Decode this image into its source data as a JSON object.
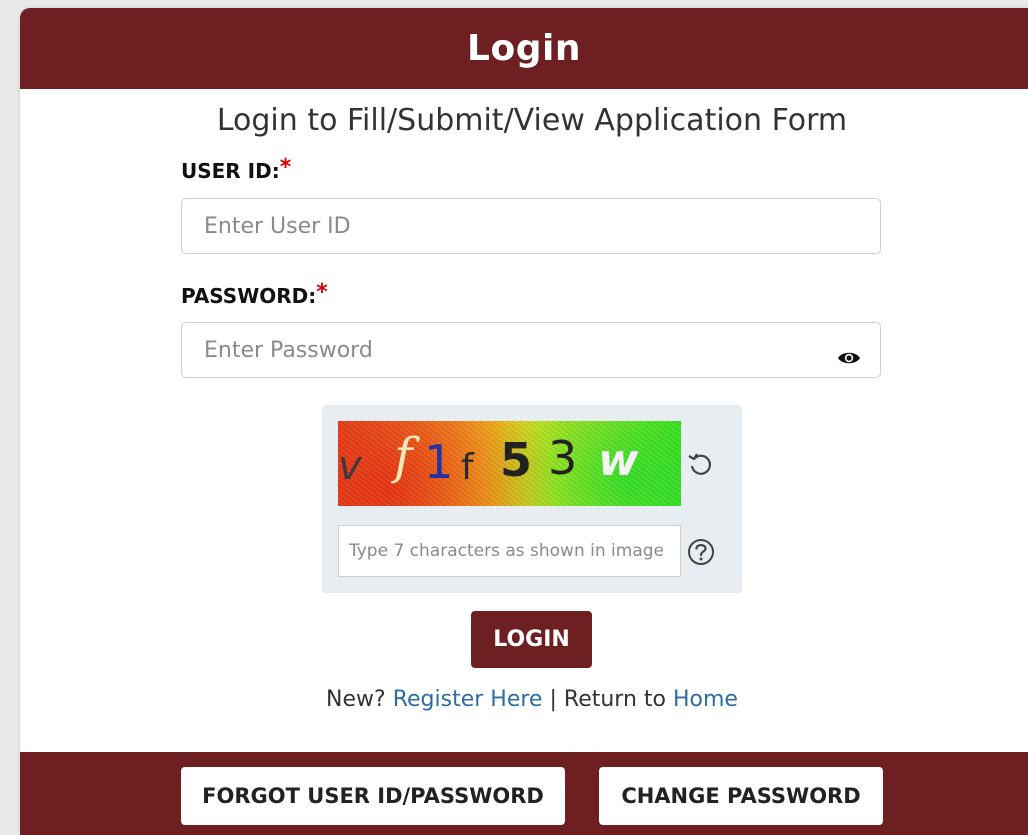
{
  "header": {
    "title": "Login"
  },
  "subtitle": "Login to Fill/Submit/View Application Form",
  "user_id": {
    "label": "USER ID:",
    "required_mark": "*",
    "placeholder": "Enter User ID",
    "value": ""
  },
  "password": {
    "label": "PASSWORD:",
    "required_mark": "*",
    "placeholder": "Enter Password",
    "value": "",
    "toggle_icon": "eye-icon"
  },
  "captcha": {
    "image_text": [
      "v",
      "f",
      "1",
      "f",
      "5",
      "3",
      "w"
    ],
    "refresh_icon": "refresh-icon",
    "input_placeholder": "Type 7 characters as shown in image",
    "input_value": "",
    "help_icon": "question-circle-icon",
    "gradient_colors": [
      "#e64a19",
      "#f4e51c",
      "#3ee51e"
    ]
  },
  "login_button": {
    "label": "LOGIN"
  },
  "links": {
    "new_prefix": "New?",
    "register_label": "Register Here",
    "separator": "|",
    "return_prefix": "Return to",
    "home_label": "Home"
  },
  "footer": {
    "forgot_label": "FORGOT USER ID/PASSWORD",
    "change_label": "CHANGE PASSWORD"
  },
  "colors": {
    "brand": "#6e1f22",
    "link": "#2e6da4",
    "required": "#d60000",
    "captcha_panel": "#e8edf2"
  }
}
